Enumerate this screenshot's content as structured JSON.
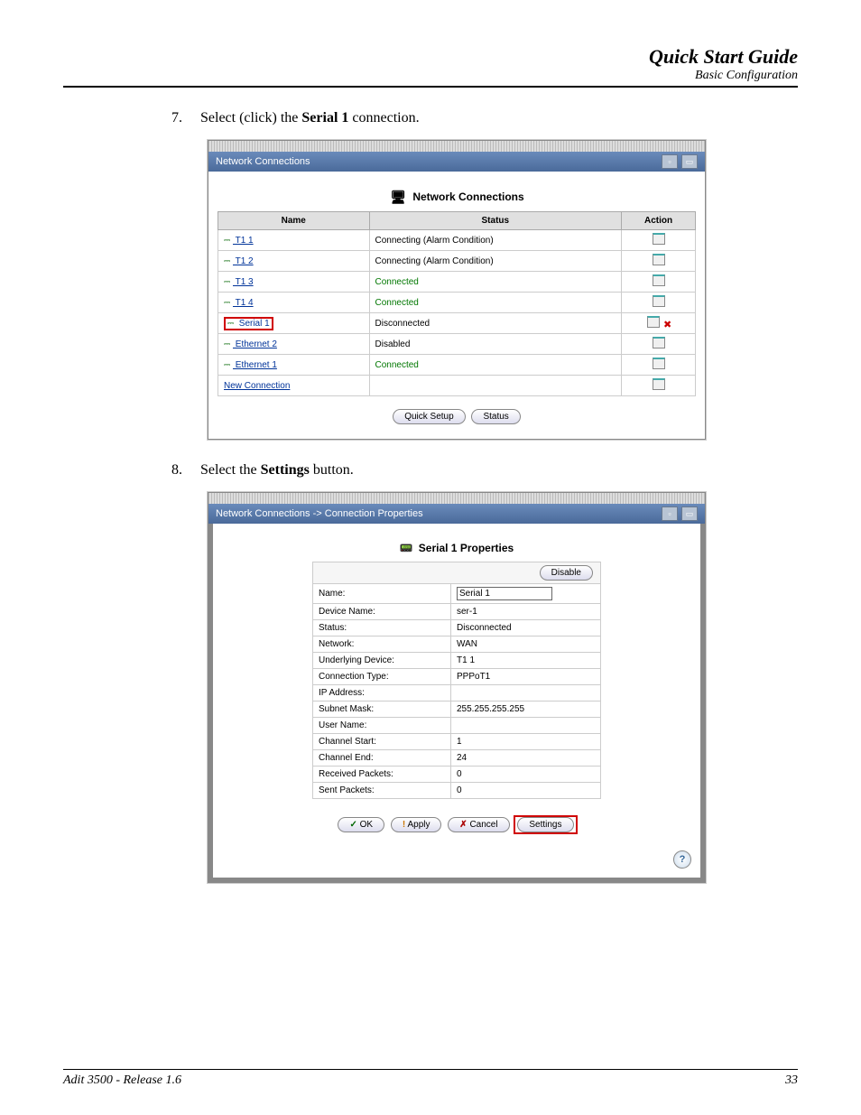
{
  "header": {
    "main": "Quick Start Guide",
    "sub": "Basic Configuration"
  },
  "steps": {
    "s7": {
      "num": "7.",
      "pre": "Select (click) the ",
      "bold": "Serial 1",
      "post": " connection."
    },
    "s8": {
      "num": "8.",
      "pre": "Select the ",
      "bold": "Settings",
      "post": " button."
    }
  },
  "panel1": {
    "titlebar": "Network Connections",
    "heading": "Network Connections",
    "cols": {
      "name": "Name",
      "status": "Status",
      "action": "Action"
    },
    "rows": [
      {
        "name": "T1 1",
        "status": "Connecting (Alarm Condition)",
        "green": false,
        "highlight": false,
        "actions": 1
      },
      {
        "name": "T1 2",
        "status": "Connecting (Alarm Condition)",
        "green": false,
        "highlight": false,
        "actions": 1
      },
      {
        "name": "T1 3",
        "status": "Connected",
        "green": true,
        "highlight": false,
        "actions": 1
      },
      {
        "name": "T1 4",
        "status": "Connected",
        "green": true,
        "highlight": false,
        "actions": 1
      },
      {
        "name": "Serial 1",
        "status": "Disconnected",
        "green": false,
        "highlight": true,
        "actions": 2
      },
      {
        "name": "Ethernet 2",
        "status": "Disabled",
        "green": false,
        "highlight": false,
        "actions": 1
      },
      {
        "name": "Ethernet 1",
        "status": "Connected",
        "green": true,
        "highlight": false,
        "actions": 1
      }
    ],
    "new_connection": "New Connection",
    "quick_setup": "Quick Setup",
    "status_btn": "Status"
  },
  "panel2": {
    "titlebar": "Network Connections -> Connection Properties",
    "heading": "Serial 1 Properties",
    "disable_btn": "Disable",
    "rows": [
      {
        "label": "Name:",
        "value": "Serial 1",
        "input": true
      },
      {
        "label": "Device Name:",
        "value": "ser-1"
      },
      {
        "label": "Status:",
        "value": "Disconnected"
      },
      {
        "label": "Network:",
        "value": "WAN"
      },
      {
        "label": "Underlying Device:",
        "value": "T1 1"
      },
      {
        "label": "Connection Type:",
        "value": "PPPoT1"
      },
      {
        "label": "IP Address:",
        "value": ""
      },
      {
        "label": "Subnet Mask:",
        "value": "255.255.255.255"
      },
      {
        "label": "User Name:",
        "value": ""
      },
      {
        "label": "Channel Start:",
        "value": "1"
      },
      {
        "label": "Channel End:",
        "value": "24"
      },
      {
        "label": "Received Packets:",
        "value": "0"
      },
      {
        "label": "Sent Packets:",
        "value": "0"
      }
    ],
    "ok": "OK",
    "apply": "Apply",
    "cancel": "Cancel",
    "settings": "Settings",
    "help": "?"
  },
  "footer": {
    "left": "Adit 3500  - Release 1.6",
    "right": "33"
  }
}
